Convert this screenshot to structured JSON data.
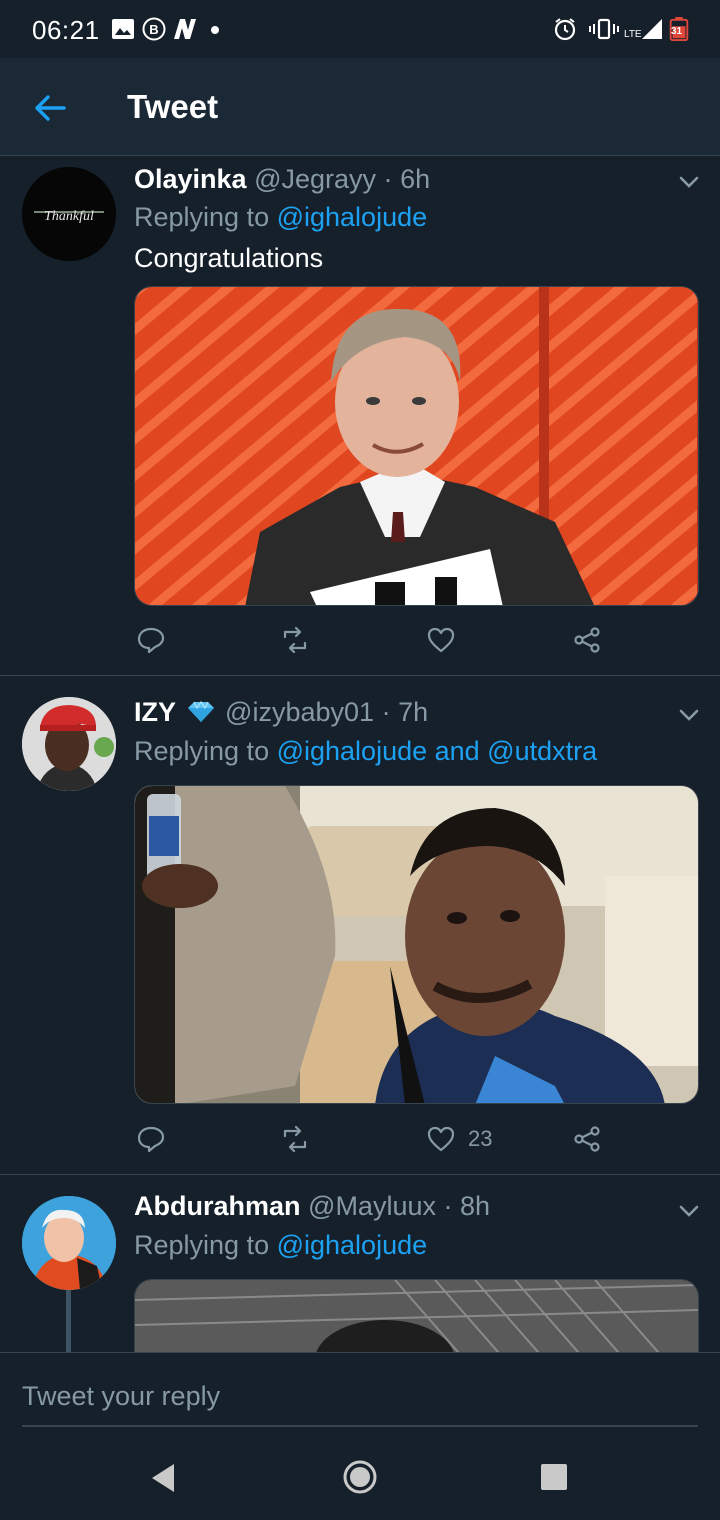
{
  "status_bar": {
    "time": "06:21",
    "network": "LTE",
    "battery_level": "31"
  },
  "app_bar": {
    "title": "Tweet"
  },
  "tweets": [
    {
      "name": "Olayinka",
      "handle": "@Jegrayy",
      "time": "6h",
      "replying_prefix": "Replying to ",
      "mentions": "@ighalojude",
      "text": "Congratulations",
      "avatar_text": "Thankful",
      "likes": ""
    },
    {
      "name": "IZY",
      "handle": "@izybaby01",
      "time": "7h",
      "replying_prefix": "Replying to ",
      "mentions": "@ighalojude and @utdxtra",
      "text": "",
      "likes": "23"
    },
    {
      "name": "Abdurahman",
      "handle": "@Mayluux",
      "time": "8h",
      "replying_prefix": "Replying to ",
      "mentions": "@ighalojude",
      "text": ""
    }
  ],
  "reply_bar": {
    "placeholder": "Tweet your reply"
  },
  "colors": {
    "background": "#15202b",
    "accent": "#1da1f2",
    "muted": "#8899a6",
    "divider": "#38444d"
  }
}
